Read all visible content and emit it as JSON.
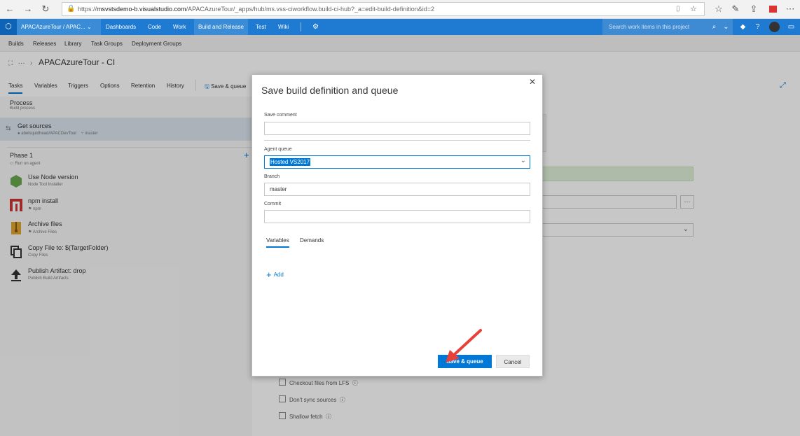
{
  "browser": {
    "url_scheme": "https://",
    "url_host": "msvstsdemo-b.visualstudio.com",
    "url_path": "/APACAzureTour/_apps/hub/ms.vss-ciworkflow.build-ci-hub?_a=edit-build-definition&id=2"
  },
  "topnav": {
    "project": "APACAzureTour / APAC...",
    "items": [
      "Dashboards",
      "Code",
      "Work",
      "Build and Release",
      "Test",
      "Wiki"
    ],
    "search_placeholder": "Search work items in this project"
  },
  "subnav": {
    "items": [
      "Builds",
      "Releases",
      "Library",
      "Task Groups",
      "Deployment Groups"
    ]
  },
  "breadcrumb": {
    "title": "APACAzureTour - CI"
  },
  "tabs": [
    "Tasks",
    "Variables",
    "Triggers",
    "Options",
    "Retention",
    "History"
  ],
  "toolbar": {
    "save_queue": "Save & queue"
  },
  "left": {
    "process_title": "Process",
    "process_sub": "Build process",
    "get_sources_title": "Get sources",
    "get_sources_repo": "abelsquidhead/APACDevTour",
    "get_sources_branch": "master",
    "phase_title": "Phase 1",
    "phase_sub": "Run on agent",
    "tasks": [
      {
        "title": "Use Node version",
        "sub": "Node Tool Installer",
        "icon": "node-icon",
        "color": "#6aa84f"
      },
      {
        "title": "npm install",
        "sub": "npm",
        "icon": "npm-icon",
        "color": "#cb3837"
      },
      {
        "title": "Archive files",
        "sub": "Archive Files",
        "icon": "archive-icon",
        "color": "#e0a630"
      },
      {
        "title": "Copy File to: $(TargetFolder)",
        "sub": "Copy Files",
        "icon": "copy-icon",
        "color": "#333333"
      },
      {
        "title": "Publish Artifact: drop",
        "sub": "Publish Build Artifacts",
        "icon": "upload-icon",
        "color": "#333333"
      }
    ]
  },
  "background_checks": [
    "Checkout files from LFS",
    "Don't sync sources",
    "Shallow fetch"
  ],
  "dialog": {
    "title": "Save build definition and queue",
    "save_comment_label": "Save comment",
    "save_comment_value": "",
    "agent_queue_label": "Agent queue",
    "agent_queue_value": "Hosted VS2017",
    "branch_label": "Branch",
    "branch_value": "master",
    "commit_label": "Commit",
    "commit_value": "",
    "tab_variables": "Variables",
    "tab_demands": "Demands",
    "add_label": "Add",
    "save_queue_button": "Save & queue",
    "cancel_button": "Cancel"
  },
  "colors": {
    "accent": "#0078d7",
    "topnav": "#1e7bd1",
    "annotation_arrow": "#e8413a"
  }
}
